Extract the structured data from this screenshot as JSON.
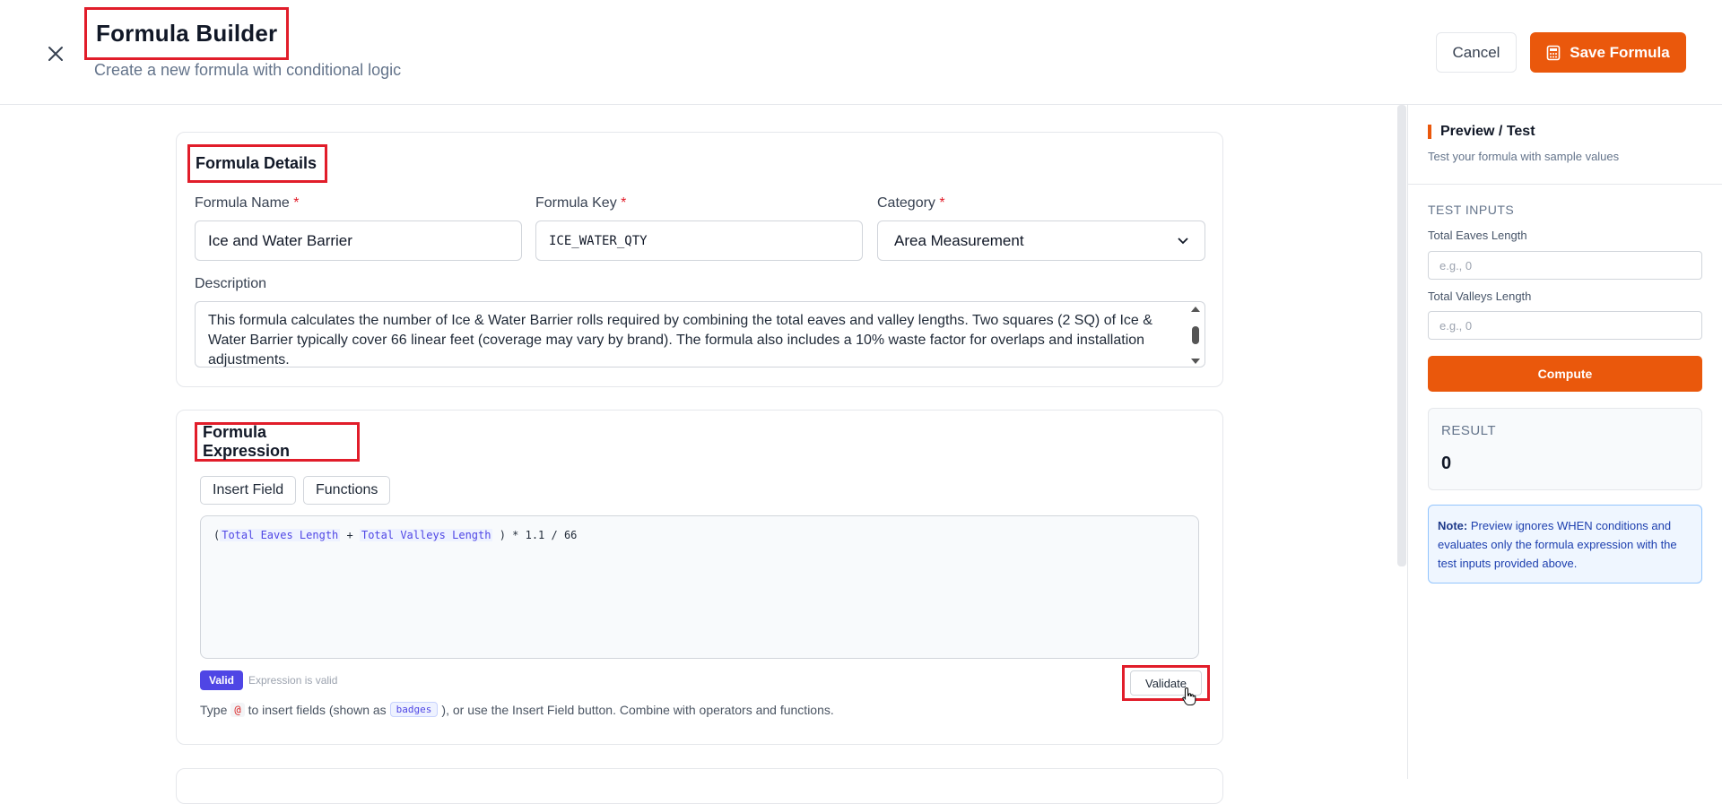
{
  "header": {
    "title": "Formula Builder",
    "subtitle": "Create a new formula with conditional logic",
    "close_icon": "close-icon",
    "cancel_label": "Cancel",
    "save_label": "Save Formula",
    "save_icon": "calculator-icon"
  },
  "details": {
    "section_title": "Formula Details",
    "name_label": "Formula Name",
    "name_value": "Ice and Water Barrier",
    "key_label": "Formula Key",
    "key_value": "ICE_WATER_QTY",
    "category_label": "Category",
    "category_value": "Area Measurement",
    "required_mark": "*",
    "description_label": "Description",
    "description_value": "This formula calculates the number of Ice & Water Barrier rolls required by combining the total eaves and valley lengths. Two squares (2 SQ) of Ice & Water Barrier typically cover 66 linear feet (coverage may vary by brand). The formula also includes a 10% waste factor for overlaps and installation adjustments."
  },
  "expression": {
    "section_title": "Formula Expression",
    "insert_field_label": "Insert Field",
    "functions_label": "Functions",
    "open_paren": "(",
    "field1": "Total Eaves Length",
    "plus": " + ",
    "field2": "Total Valleys Length",
    "tail": " ) * 1.1 / 66",
    "valid_badge": "Valid",
    "valid_text": "Expression is valid",
    "validate_label": "Validate",
    "hint_prefix": "Type",
    "hint_at": "@",
    "hint_mid": "to insert fields (shown as",
    "hint_badge": "badges",
    "hint_suffix": "), or use the Insert Field button. Combine with operators and functions."
  },
  "preview": {
    "title": "Preview / Test",
    "subtitle": "Test your formula with sample values",
    "inputs_heading": "TEST INPUTS",
    "eaves_label": "Total Eaves Length",
    "eaves_placeholder": "e.g., 0",
    "valleys_label": "Total Valleys Length",
    "valleys_placeholder": "e.g., 0",
    "compute_label": "Compute",
    "result_label": "RESULT",
    "result_value": "0",
    "note_label": "Note:",
    "note_text": "Preview ignores WHEN conditions and evaluates only the formula expression with the test inputs provided above."
  },
  "colors": {
    "accent": "#ea580c",
    "highlight": "#e11d2a",
    "valid": "#4f46e5"
  }
}
